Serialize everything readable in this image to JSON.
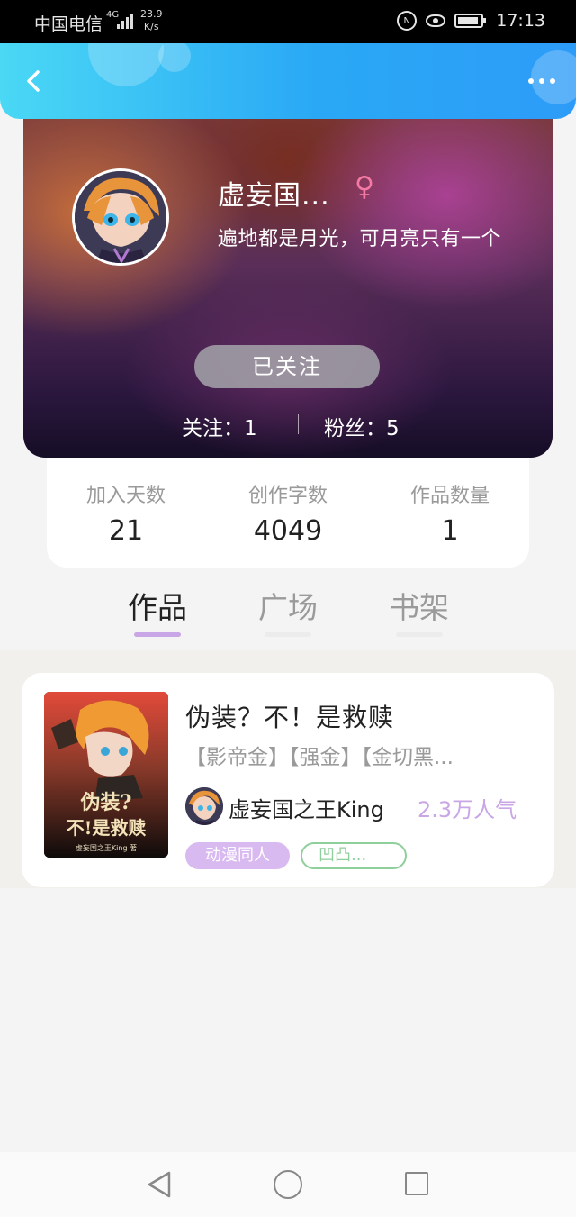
{
  "status_bar": {
    "carrier": "中国电信",
    "network": "4G",
    "speed_value": "23.9",
    "speed_unit": "K/s",
    "time": "17:13",
    "nfc_label": "N"
  },
  "header": {
    "back_icon": "chevron-left-icon",
    "more_icon": "more-dots-icon",
    "gradient_start": "#4ad8f5",
    "gradient_end": "#2d9cf8"
  },
  "profile": {
    "nickname": "虚妄国...",
    "gender_symbol": "♀",
    "bio": "遍地都是月光，可月亮只有一个",
    "follow_button": "已关注",
    "following": "关注：1",
    "fans": "粉丝：5"
  },
  "stats": [
    {
      "label": "加入天数",
      "value": "21"
    },
    {
      "label": "创作字数",
      "value": "4049"
    },
    {
      "label": "作品数量",
      "value": "1"
    }
  ],
  "tabs": [
    {
      "label": "作品",
      "active": true
    },
    {
      "label": "广场",
      "active": false
    },
    {
      "label": "书架",
      "active": false
    }
  ],
  "tab_accent_color": "#c9a6e6",
  "work": {
    "title": "伪装？不！是救赎",
    "tags": "【影帝金】【强金】【金切黑...",
    "cover_title_line1": "伪装?",
    "cover_title_line2": "不!是救赎",
    "cover_author_line": "虚妄国之王King 著",
    "author": "虚妄国之王King",
    "popularity": "2.3万人气",
    "category": "动漫同人",
    "tag_chip": "凹凸..."
  },
  "navbar": {
    "back_icon": "triangle-back-icon",
    "home_icon": "circle-home-icon",
    "recent_icon": "square-recent-icon"
  }
}
